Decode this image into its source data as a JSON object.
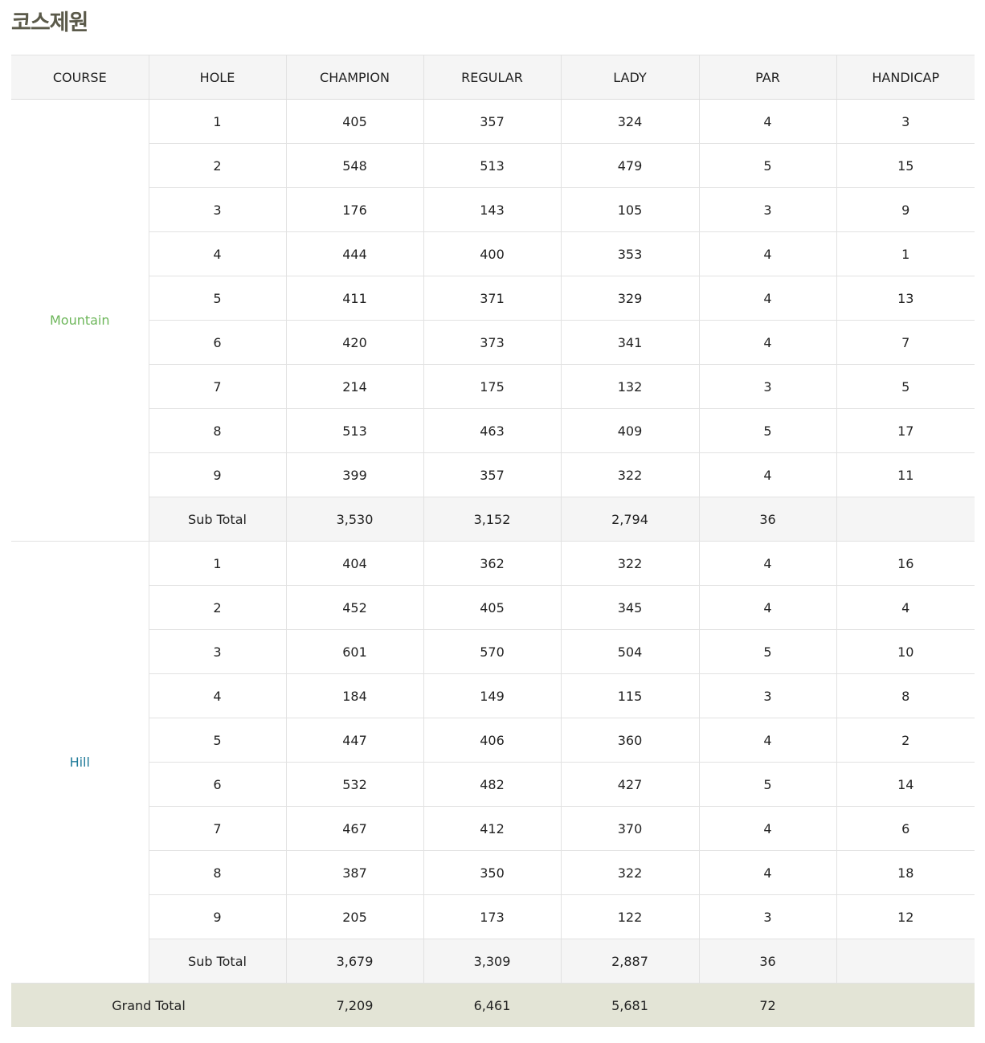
{
  "page": {
    "title": "코스제원"
  },
  "table": {
    "headers": [
      "COURSE",
      "HOLE",
      "CHAMPION",
      "REGULAR",
      "LADY",
      "PAR",
      "HANDICAP"
    ],
    "courses": [
      {
        "name": "Mountain",
        "color": "#6db65a",
        "rows": [
          [
            "1",
            "405",
            "357",
            "324",
            "4",
            "3"
          ],
          [
            "2",
            "548",
            "513",
            "479",
            "5",
            "15"
          ],
          [
            "3",
            "176",
            "143",
            "105",
            "3",
            "9"
          ],
          [
            "4",
            "444",
            "400",
            "353",
            "4",
            "1"
          ],
          [
            "5",
            "411",
            "371",
            "329",
            "4",
            "13"
          ],
          [
            "6",
            "420",
            "373",
            "341",
            "4",
            "7"
          ],
          [
            "7",
            "214",
            "175",
            "132",
            "3",
            "5"
          ],
          [
            "8",
            "513",
            "463",
            "409",
            "5",
            "17"
          ],
          [
            "9",
            "399",
            "357",
            "322",
            "4",
            "11"
          ]
        ],
        "subtotal": [
          "Sub Total",
          "3,530",
          "3,152",
          "2,794",
          "36",
          ""
        ]
      },
      {
        "name": "Hill",
        "color": "#1f7a99",
        "rows": [
          [
            "1",
            "404",
            "362",
            "322",
            "4",
            "16"
          ],
          [
            "2",
            "452",
            "405",
            "345",
            "4",
            "4"
          ],
          [
            "3",
            "601",
            "570",
            "504",
            "5",
            "10"
          ],
          [
            "4",
            "184",
            "149",
            "115",
            "3",
            "8"
          ],
          [
            "5",
            "447",
            "406",
            "360",
            "4",
            "2"
          ],
          [
            "6",
            "532",
            "482",
            "427",
            "5",
            "14"
          ],
          [
            "7",
            "467",
            "412",
            "370",
            "4",
            "6"
          ],
          [
            "8",
            "387",
            "350",
            "322",
            "4",
            "18"
          ],
          [
            "9",
            "205",
            "173",
            "122",
            "3",
            "12"
          ]
        ],
        "subtotal": [
          "Sub Total",
          "3,679",
          "3,309",
          "2,887",
          "36",
          ""
        ]
      }
    ],
    "grand_total": [
      "Grand Total",
      "7,209",
      "6,461",
      "5,681",
      "72",
      ""
    ]
  }
}
